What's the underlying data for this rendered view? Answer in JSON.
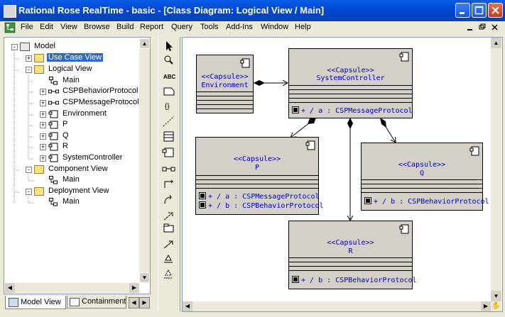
{
  "window": {
    "title": "Rational Rose RealTime - basic - [Class Diagram: Logical View / Main]"
  },
  "menu": [
    "File",
    "Edit",
    "View",
    "Browse",
    "Build",
    "Report",
    "Query",
    "Tools",
    "Add-Ins",
    "Window",
    "Help"
  ],
  "browser": {
    "tree": [
      {
        "label": "Model",
        "icon": "model-icon",
        "expander": "-",
        "level": 0
      },
      {
        "label": "Use Case View",
        "icon": "folder-icon",
        "expander": "+",
        "level": 1,
        "selected": true
      },
      {
        "label": "Logical View",
        "icon": "folder-icon",
        "expander": "-",
        "level": 1
      },
      {
        "label": "Main",
        "icon": "class-diagram-icon",
        "expander": "",
        "level": 2
      },
      {
        "label": "CSPBehaviorProtocol",
        "icon": "protocol-icon",
        "expander": "+",
        "level": 2
      },
      {
        "label": "CSPMessageProtocol",
        "icon": "protocol-icon",
        "expander": "+",
        "level": 2
      },
      {
        "label": "Environment",
        "icon": "capsule-icon",
        "expander": "+",
        "level": 2
      },
      {
        "label": "P",
        "icon": "capsule-icon",
        "expander": "+",
        "level": 2
      },
      {
        "label": "Q",
        "icon": "capsule-icon",
        "expander": "+",
        "level": 2
      },
      {
        "label": "R",
        "icon": "capsule-icon",
        "expander": "+",
        "level": 2
      },
      {
        "label": "SystemController",
        "icon": "capsule-icon",
        "expander": "+",
        "level": 2
      },
      {
        "label": "Component View",
        "icon": "folder-icon",
        "expander": "-",
        "level": 1
      },
      {
        "label": "Main",
        "icon": "component-diagram-icon",
        "expander": "",
        "level": 2
      },
      {
        "label": "Deployment View",
        "icon": "folder-icon",
        "expander": "-",
        "level": 1
      },
      {
        "label": "Main",
        "icon": "deployment-diagram-icon",
        "expander": "",
        "level": 2
      }
    ],
    "tabs": [
      "Model View",
      "Containment V"
    ]
  },
  "toolbox": [
    "selector-tool",
    "zoom-tool",
    "ABC",
    "note-tool",
    "package-tool",
    "dashed-line-tool",
    "class-tool",
    "capsule-tool",
    "protocol-tool",
    "association-tool",
    "dependency-tool",
    "generalization-tool",
    "container-tool",
    "aggregation-tool",
    "realize-tool",
    "anchor-tool"
  ],
  "diagram": {
    "capsules": [
      {
        "id": "env",
        "stereotype": "<<Capsule>>",
        "name": "Environment",
        "ports": []
      },
      {
        "id": "sys",
        "stereotype": "<<Capsule>>",
        "name": "SystemController",
        "ports": [
          "+ / a : CSPMessageProtocol"
        ]
      },
      {
        "id": "p",
        "stereotype": "<<Capsule>>",
        "name": "P",
        "ports": [
          "+ / a : CSPMessageProtocol",
          "+ / b : CSPBehaviorProtocol"
        ]
      },
      {
        "id": "q",
        "stereotype": "<<Capsule>>",
        "name": "Q",
        "ports": [
          "+ / b : CSPBehaviorProtocol"
        ]
      },
      {
        "id": "r",
        "stereotype": "<<Capsule>>",
        "name": "R",
        "ports": [
          "+ / b : CSPBehaviorProtocol"
        ]
      }
    ]
  }
}
